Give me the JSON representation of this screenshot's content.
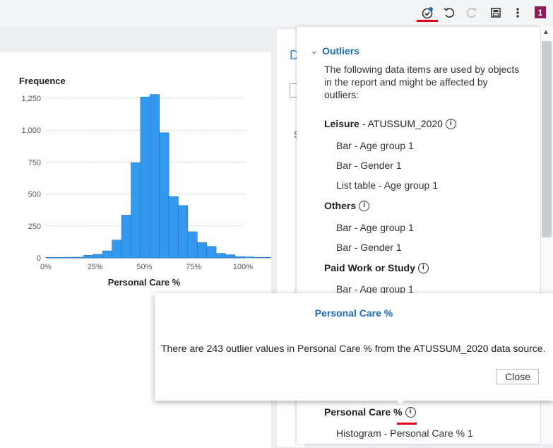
{
  "toolbar": {
    "icons": [
      "outlier-alert-icon",
      "undo-icon",
      "redo-icon",
      "save-icon",
      "more-vert-icon"
    ],
    "badge": "1",
    "accent": "#e3001b"
  },
  "chart": {
    "ylabel": "Frequence",
    "xlabel": "Personal Care %"
  },
  "chart_data": {
    "type": "bar",
    "title": "",
    "xlabel": "Personal Care %",
    "ylabel": "Frequence",
    "x_ticks": [
      "0%",
      "25%",
      "50%",
      "75%",
      "100%"
    ],
    "y_ticks": [
      "0",
      "250",
      "500",
      "750",
      "1,000",
      "1,250"
    ],
    "ylim": [
      0,
      1250
    ],
    "xlim": [
      0,
      100
    ],
    "bin_width": 4.8,
    "values": [
      4,
      4,
      5,
      6,
      20,
      28,
      55,
      140,
      335,
      745,
      1260,
      1280,
      980,
      480,
      410,
      205,
      120,
      90,
      35,
      25,
      10,
      8,
      4,
      4,
      2,
      2,
      2,
      2,
      2
    ],
    "color": "#3399ee",
    "grid": true
  },
  "panel": {
    "outliers_label": "Outliers",
    "intro": "The following data items are used by objects in the report and might be affected by outliers:",
    "groups": [
      {
        "name": "Leisure",
        "suffix": " - ATUSSUM_2020",
        "items": [
          "Bar - Age group 1",
          "Bar - Gender 1",
          "List table - Age group 1"
        ]
      },
      {
        "name": "Others",
        "suffix": "",
        "items": [
          "Bar - Age group 1",
          "Bar - Gender 1"
        ]
      },
      {
        "name": "Paid Work or Study",
        "suffix": "",
        "items": [
          "Bar - Age group 1"
        ]
      },
      {
        "name": "Personal Care %",
        "suffix": "",
        "items": [
          "Histogram - Personal Care % 1"
        ]
      }
    ]
  },
  "popup": {
    "title": "Personal Care %",
    "message": "There are 243 outlier values in Personal Care % from the ATUSSUM_2020 data source.",
    "close": "Close"
  },
  "mid": {
    "letter": "D",
    "s": "S"
  }
}
